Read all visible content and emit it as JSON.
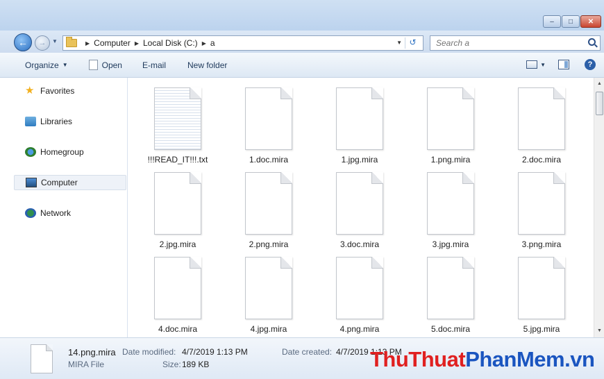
{
  "window": {
    "controls": {
      "minimize": "–",
      "maximize": "□",
      "close": "✕"
    }
  },
  "address": {
    "breadcrumb": [
      "Computer",
      "Local Disk (C:)",
      "a"
    ],
    "search_placeholder": "Search a"
  },
  "toolbar": {
    "organize": "Organize",
    "open": "Open",
    "email": "E-mail",
    "new_folder": "New folder"
  },
  "nav": {
    "items": [
      {
        "label": "Favorites",
        "icon": "star-icon"
      },
      {
        "label": "Libraries",
        "icon": "library-icon"
      },
      {
        "label": "Homegroup",
        "icon": "homegroup-icon"
      },
      {
        "label": "Computer",
        "icon": "computer-icon",
        "selected": true
      },
      {
        "label": "Network",
        "icon": "network-icon"
      }
    ]
  },
  "files": [
    {
      "name": "!!!READ_IT!!!.txt",
      "kind": "txt"
    },
    {
      "name": "1.doc.mira",
      "kind": "blank"
    },
    {
      "name": "1.jpg.mira",
      "kind": "blank"
    },
    {
      "name": "1.png.mira",
      "kind": "blank"
    },
    {
      "name": "2.doc.mira",
      "kind": "blank"
    },
    {
      "name": "2.jpg.mira",
      "kind": "blank"
    },
    {
      "name": "2.png.mira",
      "kind": "blank"
    },
    {
      "name": "3.doc.mira",
      "kind": "blank"
    },
    {
      "name": "3.jpg.mira",
      "kind": "blank"
    },
    {
      "name": "3.png.mira",
      "kind": "blank"
    },
    {
      "name": "4.doc.mira",
      "kind": "blank"
    },
    {
      "name": "4.jpg.mira",
      "kind": "blank"
    },
    {
      "name": "4.png.mira",
      "kind": "blank"
    },
    {
      "name": "5.doc.mira",
      "kind": "blank"
    },
    {
      "name": "5.jpg.mira",
      "kind": "blank"
    }
  ],
  "details": {
    "name": "14.png.mira",
    "type": "MIRA File",
    "modified_label": "Date modified:",
    "modified_value": "4/7/2019 1:13 PM",
    "size_label": "Size:",
    "size_value": "189 KB",
    "created_label": "Date created:",
    "created_value": "4/7/2019 1:13 PM"
  },
  "watermark": {
    "part1": "ThuThuat",
    "part2": "PhanMem",
    "part3": ".vn"
  }
}
